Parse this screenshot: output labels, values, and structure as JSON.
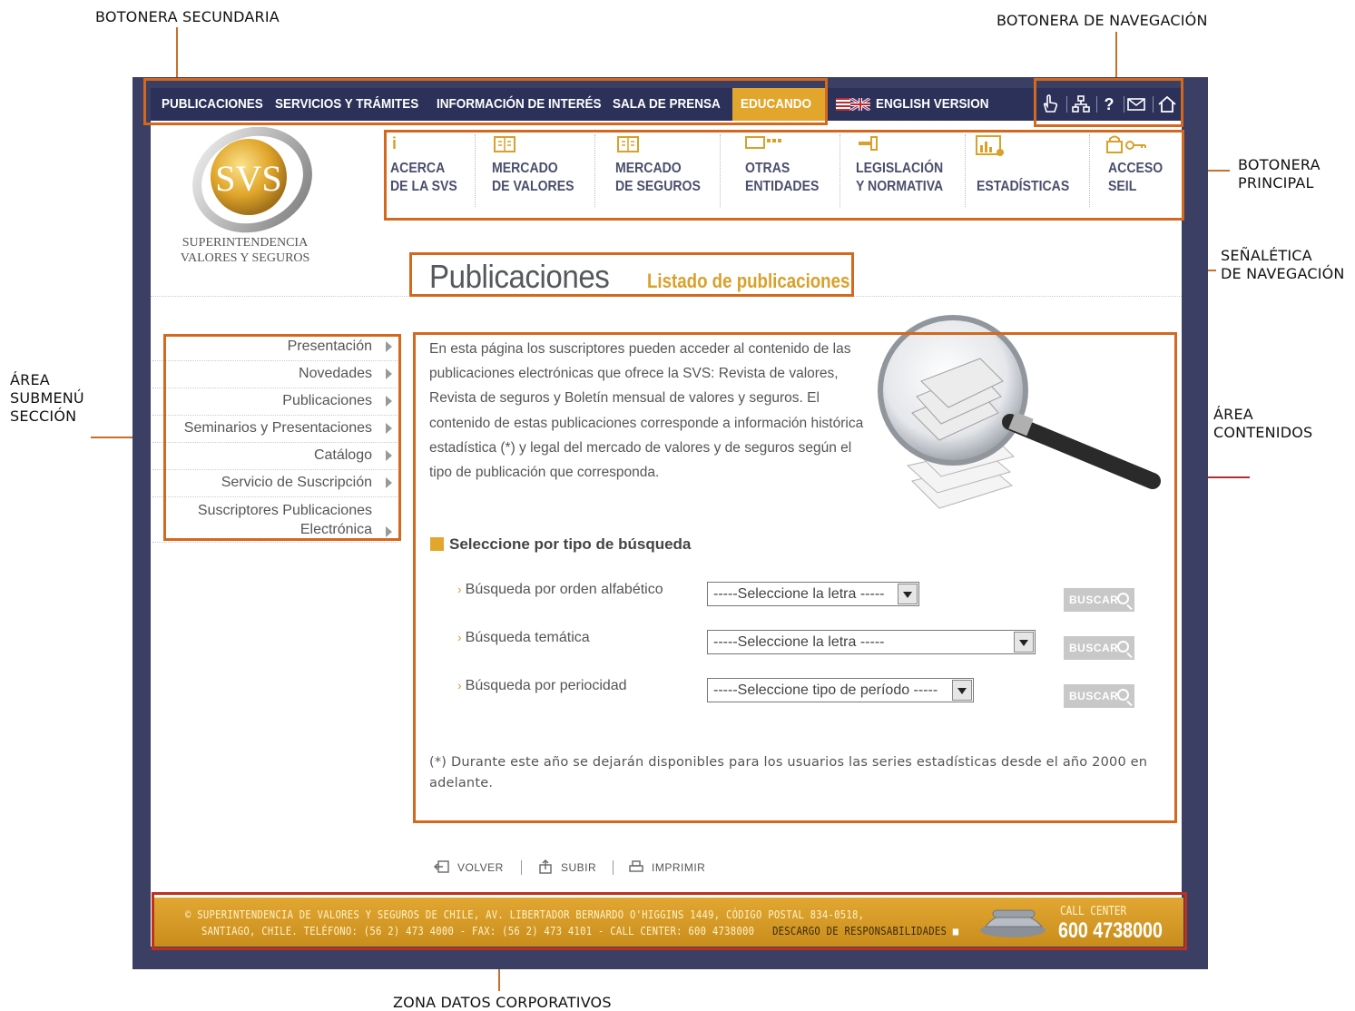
{
  "annotations": {
    "botonera_secundaria": "BOTONERA SECUNDARIA",
    "botonera_navegacion": "BOTONERA DE NAVEGACIÓN",
    "botonera_principal_1": "BOTONERA",
    "botonera_principal_2": "PRINCIPAL",
    "senaletica_1": "SEÑALÉTICA",
    "senaletica_2": "DE NAVEGACIÓN",
    "area_submenu_1": "ÁREA",
    "area_submenu_2": "SUBMENÚ",
    "area_submenu_3": "SECCIÓN",
    "area_contenidos_1": "ÁREA",
    "area_contenidos_2": "CONTENIDOS",
    "zona_datos": "ZONA DATOS CORPORATIVOS"
  },
  "secondary_nav": {
    "items": [
      "PUBLICACIONES",
      "SERVICIOS Y TRÁMITES",
      "INFORMACIÓN DE INTERÉS",
      "SALA DE PRENSA",
      "EDUCANDO"
    ],
    "english": "ENGLISH VERSION",
    "icons": [
      "hand-pointer-icon",
      "sitemap-icon",
      "help-icon",
      "mail-icon",
      "home-icon"
    ],
    "help_glyph": "?"
  },
  "logo": {
    "letters": "SVS",
    "line1": "SUPERINTENDENCIA",
    "line2": "VALORES Y SEGUROS"
  },
  "main_nav": [
    {
      "l1": "ACERCA",
      "l2": "DE LA SVS",
      "icon": "info-icon"
    },
    {
      "l1": "MERCADO",
      "l2": "DE VALORES",
      "icon": "book-icon"
    },
    {
      "l1": "MERCADO",
      "l2": "DE SEGUROS",
      "icon": "book-icon"
    },
    {
      "l1": "OTRAS",
      "l2": "ENTIDADES",
      "icon": "entity-icon"
    },
    {
      "l1": "LEGISLACIÓN",
      "l2": "Y NORMATIVA",
      "icon": "gavel-icon"
    },
    {
      "l1": "",
      "l2": "ESTADÍSTICAS",
      "icon": "chart-icon"
    },
    {
      "l1": "ACCESO",
      "l2": "SEIL",
      "icon": "lock-key-icon"
    }
  ],
  "signage": {
    "title": "Publicaciones",
    "subtitle": "Listado de publicaciones"
  },
  "submenu": [
    "Presentación",
    "Novedades",
    "Publicaciones",
    "Seminarios y Presentaciones",
    "Catálogo",
    "Servicio de Suscripción",
    "Suscriptores Publicaciones",
    "Electrónica"
  ],
  "content": {
    "intro": "En esta página los suscriptores pueden acceder al contenido de las publicaciones electrónicas que ofrece la SVS: Revista de valores, Revista de seguros y Boletín mensual de valores y seguros. El contenido de estas publicaciones corresponde a información histórica estadística (*) y legal del mercado de valores y de seguros según el tipo de publicación que corresponda.",
    "select_title": "Seleccione por tipo de búsqueda",
    "searches": [
      {
        "label": "Búsqueda por orden alfabético",
        "value": "-----Seleccione la letra -----"
      },
      {
        "label": "Búsqueda temática",
        "value": "-----Seleccione la letra -----"
      },
      {
        "label": "Búsqueda por periocidad",
        "value": "-----Seleccione tipo de período -----"
      }
    ],
    "buscar": "BUSCAR",
    "note": "(*) Durante este año se dejarán disponibles para los usuarios las series estadísticas desde el año 2000 en adelante."
  },
  "bottom_links": [
    "VOLVER",
    "SUBIR",
    "IMPRIMIR"
  ],
  "footer": {
    "line1": "© SUPERINTENDENCIA DE VALORES Y SEGUROS DE CHILE, AV. LIBERTADOR BERNARDO O'HIGGINS 1449, CÓDIGO POSTAL 834-0518,",
    "line2": "SANTIAGO, CHILE. TELÉFONO: (56 2) 473 4000 - FAX: (56 2) 473 4101 - CALL CENTER: 600 4738000",
    "disclaimer": "DESCARGO DE RESPONSABILIDADES",
    "cc_label": "CALL CENTER",
    "cc_number": "600 4738000"
  },
  "colors": {
    "accent": "#e3a62c",
    "nav_bg": "#2b3158",
    "frame": "#3a3f63",
    "annotation": "#d2691e"
  }
}
